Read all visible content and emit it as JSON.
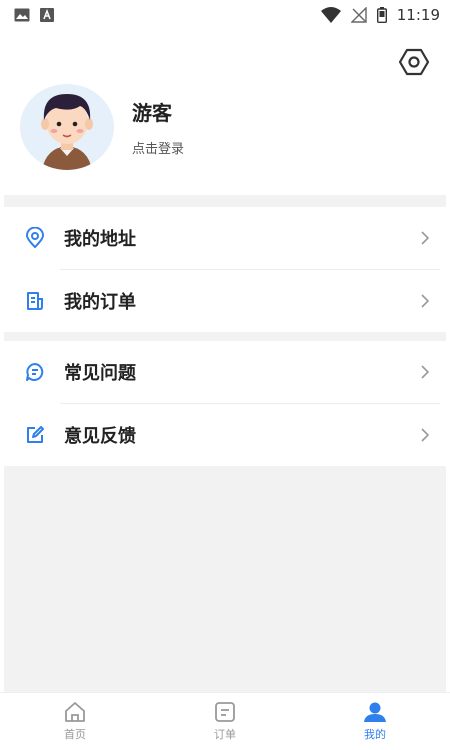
{
  "status_bar": {
    "time": "11:19"
  },
  "profile": {
    "name": "游客",
    "subtitle": "点击登录"
  },
  "menu_group_1": [
    {
      "label": "我的地址",
      "icon": "location-icon"
    },
    {
      "label": "我的订单",
      "icon": "order-icon"
    }
  ],
  "menu_group_2": [
    {
      "label": "常见问题",
      "icon": "faq-icon"
    },
    {
      "label": "意见反馈",
      "icon": "feedback-icon"
    }
  ],
  "tabbar": {
    "tabs": [
      {
        "label": "首页",
        "icon": "home-icon",
        "active": false
      },
      {
        "label": "订单",
        "icon": "order-tab-icon",
        "active": false
      },
      {
        "label": "我的",
        "icon": "user-icon",
        "active": true
      }
    ]
  },
  "colors": {
    "accent": "#2f80ed",
    "gray_bg": "#f2f2f2",
    "inactive": "#999999"
  }
}
